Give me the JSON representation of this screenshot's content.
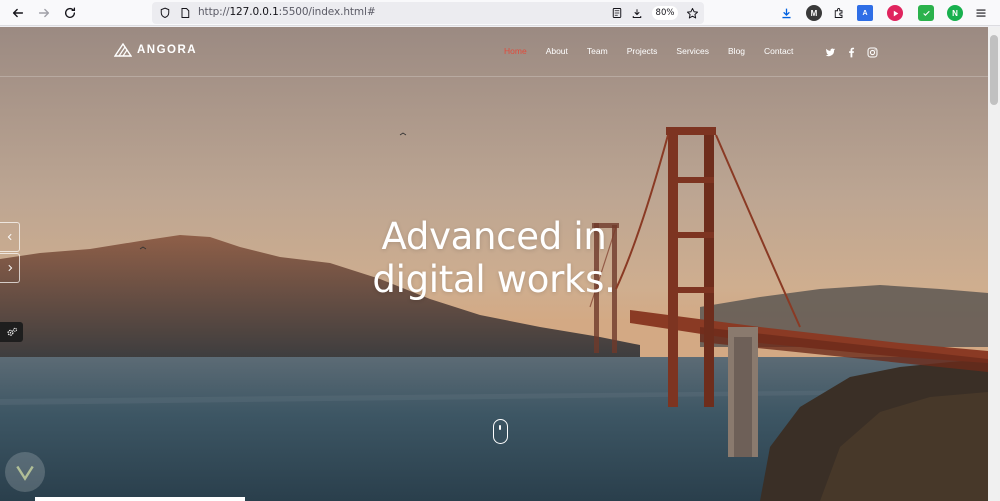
{
  "browser": {
    "url_prefix": "http://",
    "url_host": "127.0.0.1",
    "url_rest": ":5500/index.html#",
    "zoom": "80%"
  },
  "site": {
    "logo": "ANGORA",
    "menu": [
      {
        "label": "Home",
        "active": true
      },
      {
        "label": "About",
        "active": false
      },
      {
        "label": "Team",
        "active": false
      },
      {
        "label": "Projects",
        "active": false
      },
      {
        "label": "Services",
        "active": false
      },
      {
        "label": "Blog",
        "active": false
      },
      {
        "label": "Contact",
        "active": false
      }
    ],
    "social": [
      "twitter-icon",
      "facebook-icon",
      "instagram-icon"
    ]
  },
  "hero": {
    "line1": "Advanced in",
    "line2": "digital works."
  },
  "colors": {
    "accent": "#e04b3c",
    "text": "#ffffff"
  }
}
